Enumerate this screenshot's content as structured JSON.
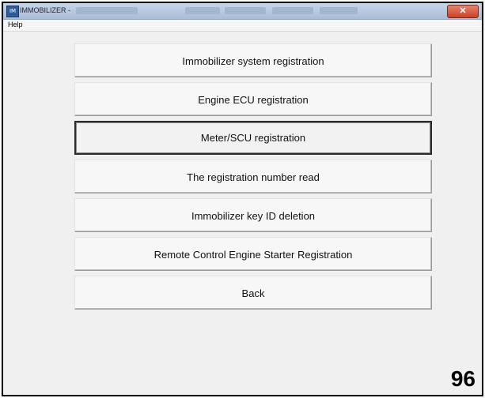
{
  "window": {
    "title": "IMMOBILIZER -",
    "icon": "immobilizer-app-icon",
    "close_glyph": "✕"
  },
  "menu": {
    "items": [
      "Help"
    ]
  },
  "buttons": [
    {
      "label": "Immobilizer system registration",
      "selected": false
    },
    {
      "label": "Engine ECU registration",
      "selected": false
    },
    {
      "label": "Meter/SCU registration",
      "selected": true
    },
    {
      "label": "The registration number read",
      "selected": false
    },
    {
      "label": "Immobilizer key ID deletion",
      "selected": false
    },
    {
      "label": "Remote Control Engine Starter Registration",
      "selected": false
    },
    {
      "label": "Back",
      "selected": false
    }
  ],
  "page_number": "96"
}
